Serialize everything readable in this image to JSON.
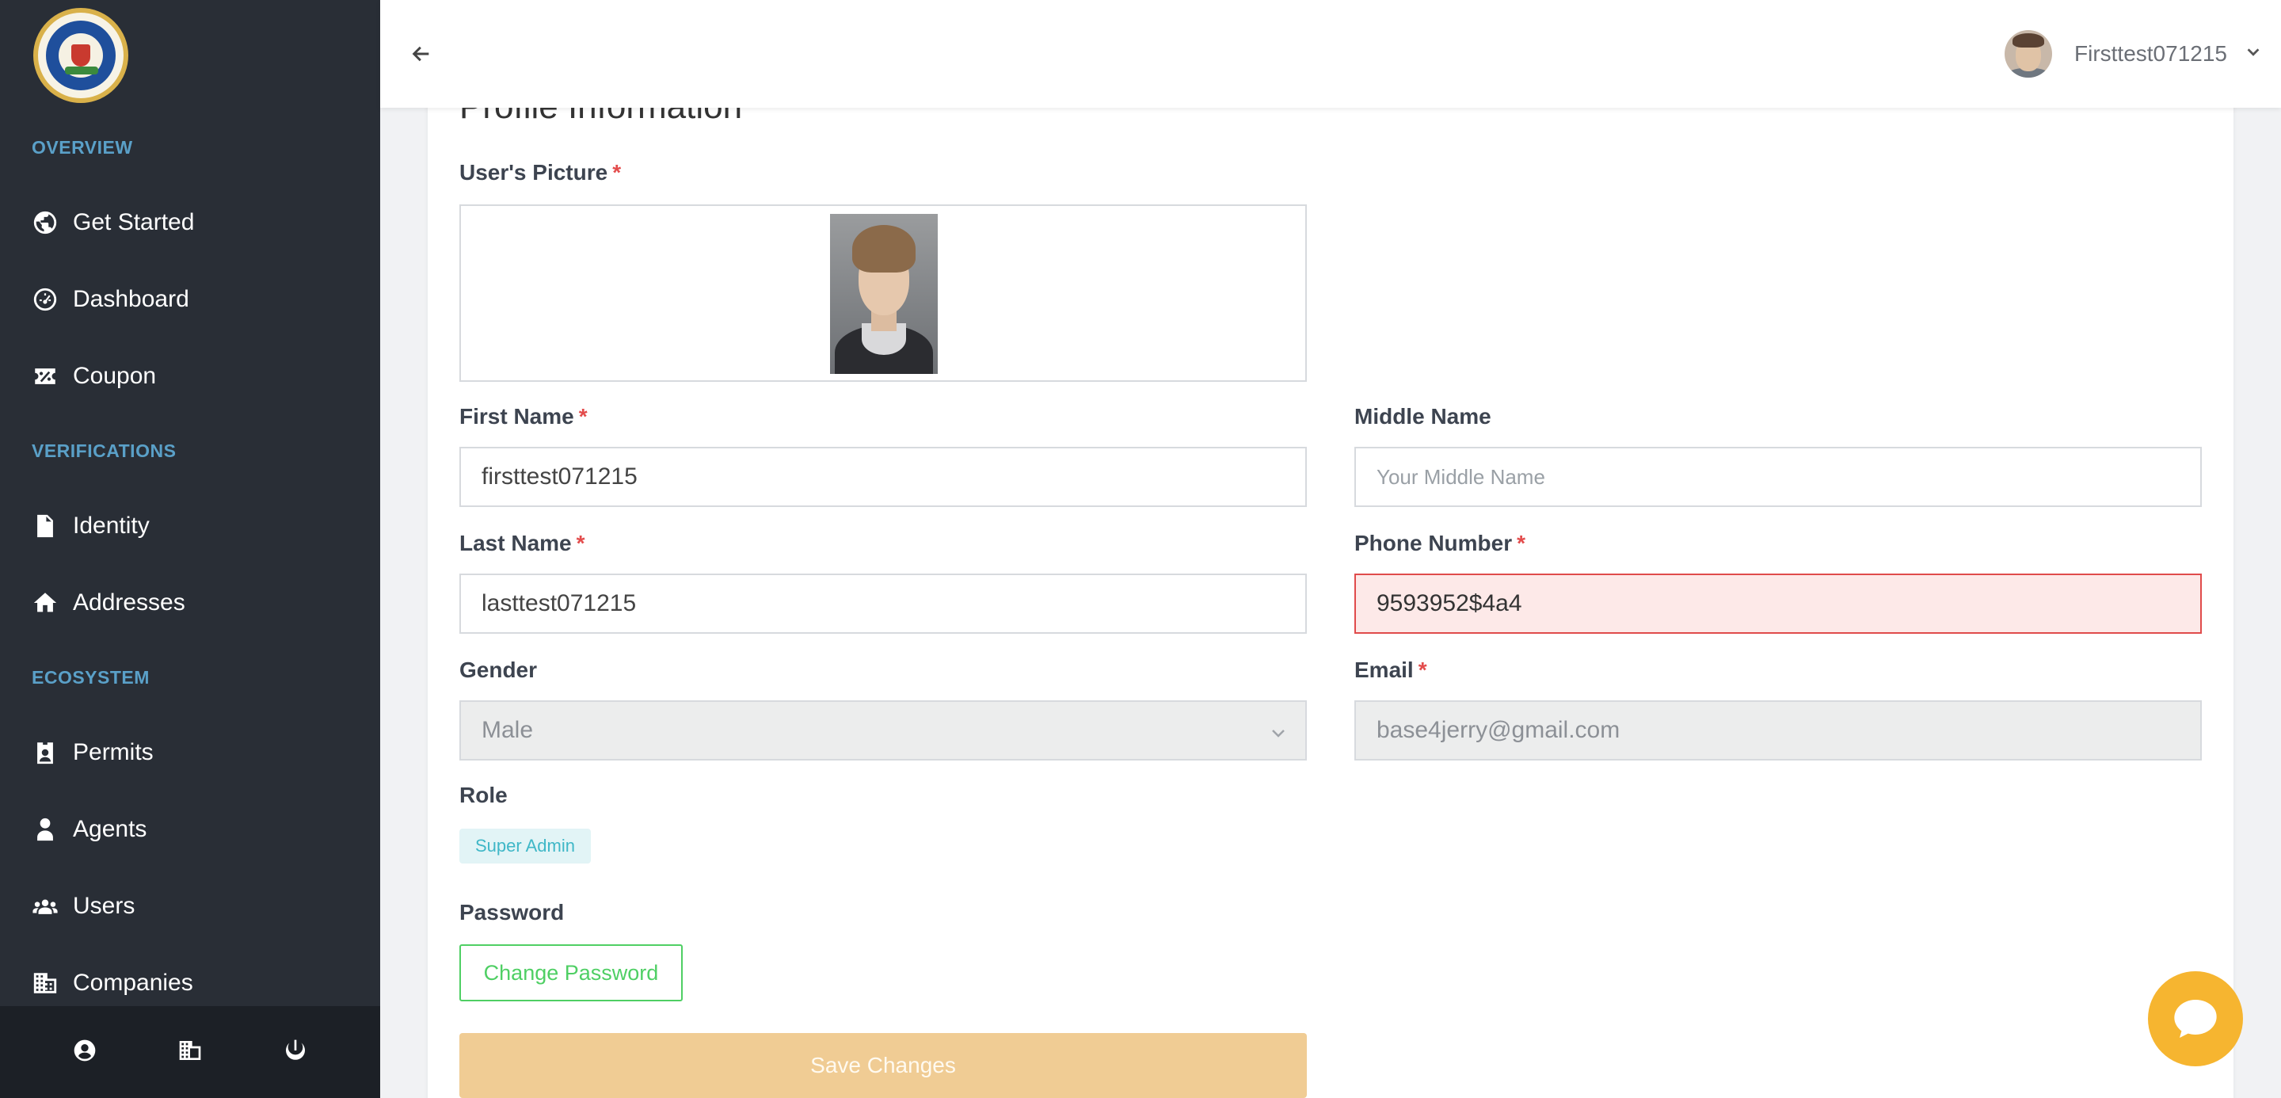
{
  "sidebar": {
    "sections": [
      {
        "title": "OVERVIEW"
      },
      {
        "title": "VERIFICATIONS"
      },
      {
        "title": "ECOSYSTEM"
      }
    ],
    "items": [
      {
        "label": "Get Started",
        "icon": "globe-icon"
      },
      {
        "label": "Dashboard",
        "icon": "gauge-icon"
      },
      {
        "label": "Coupon",
        "icon": "ticket-icon"
      },
      {
        "label": "Identity",
        "icon": "id-document-icon"
      },
      {
        "label": "Addresses",
        "icon": "home-icon"
      },
      {
        "label": "Permits",
        "icon": "badge-icon"
      },
      {
        "label": "Agents",
        "icon": "agent-icon"
      },
      {
        "label": "Users",
        "icon": "users-icon"
      },
      {
        "label": "Companies",
        "icon": "building-icon"
      }
    ],
    "footer_icons": [
      "user-circle-icon",
      "building-icon",
      "power-icon"
    ]
  },
  "header": {
    "user_name": "Firsttest071215"
  },
  "form": {
    "title": "Profile Information",
    "picture_label": "User's Picture",
    "required_mark": "*",
    "first_name_label": "First Name",
    "first_name_value": "firsttest071215",
    "middle_name_label": "Middle Name",
    "middle_name_placeholder": "Your Middle Name",
    "last_name_label": "Last Name",
    "last_name_value": "lasttest071215",
    "phone_label": "Phone Number",
    "phone_value": "9593952$4a4",
    "gender_label": "Gender",
    "gender_value": "Male",
    "email_label": "Email",
    "email_value": "base4jerry@gmail.com",
    "role_label": "Role",
    "role_value": "Super Admin",
    "password_label": "Password",
    "change_password_label": "Change Password",
    "save_label": "Save Changes"
  },
  "colors": {
    "sidebar_bg": "#292e36",
    "section_title": "#5aa0c8",
    "error": "#e04b4b",
    "success_outline": "#4fcf64",
    "save_button": "#f0cc94",
    "chat_button": "#f6b530"
  }
}
